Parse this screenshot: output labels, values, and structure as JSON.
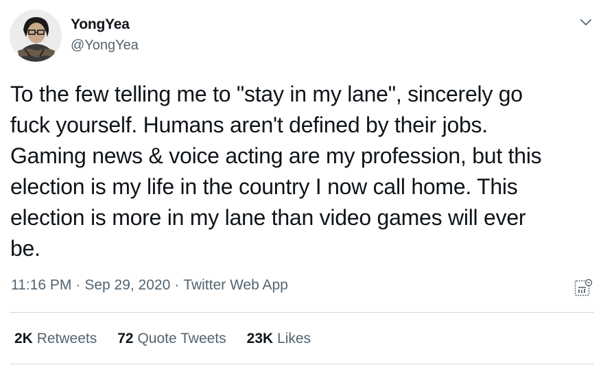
{
  "user": {
    "display_name": "YongYea",
    "handle": "@YongYea"
  },
  "tweet": {
    "text": "To the few telling me to \"stay in my lane\", sincerely go\nfuck yourself. Humans aren't defined by their jobs.\nGaming news & voice acting are my profession, but this\nelection is my life in the country I now call home. This\nelection is more in my lane than video games will ever\nbe.",
    "time": "11:16 PM",
    "separator": "·",
    "date": "Sep 29, 2020",
    "source": "Twitter Web App"
  },
  "stats": [
    {
      "count": "2K",
      "label": "Retweets"
    },
    {
      "count": "72",
      "label": "Quote Tweets"
    },
    {
      "count": "23K",
      "label": "Likes"
    }
  ],
  "icons": {
    "more": "chevron-down-icon",
    "analytics": "analytics-icon"
  },
  "colors": {
    "text_primary": "#0f1419",
    "text_secondary": "#536471",
    "divider": "#cfd9de"
  }
}
